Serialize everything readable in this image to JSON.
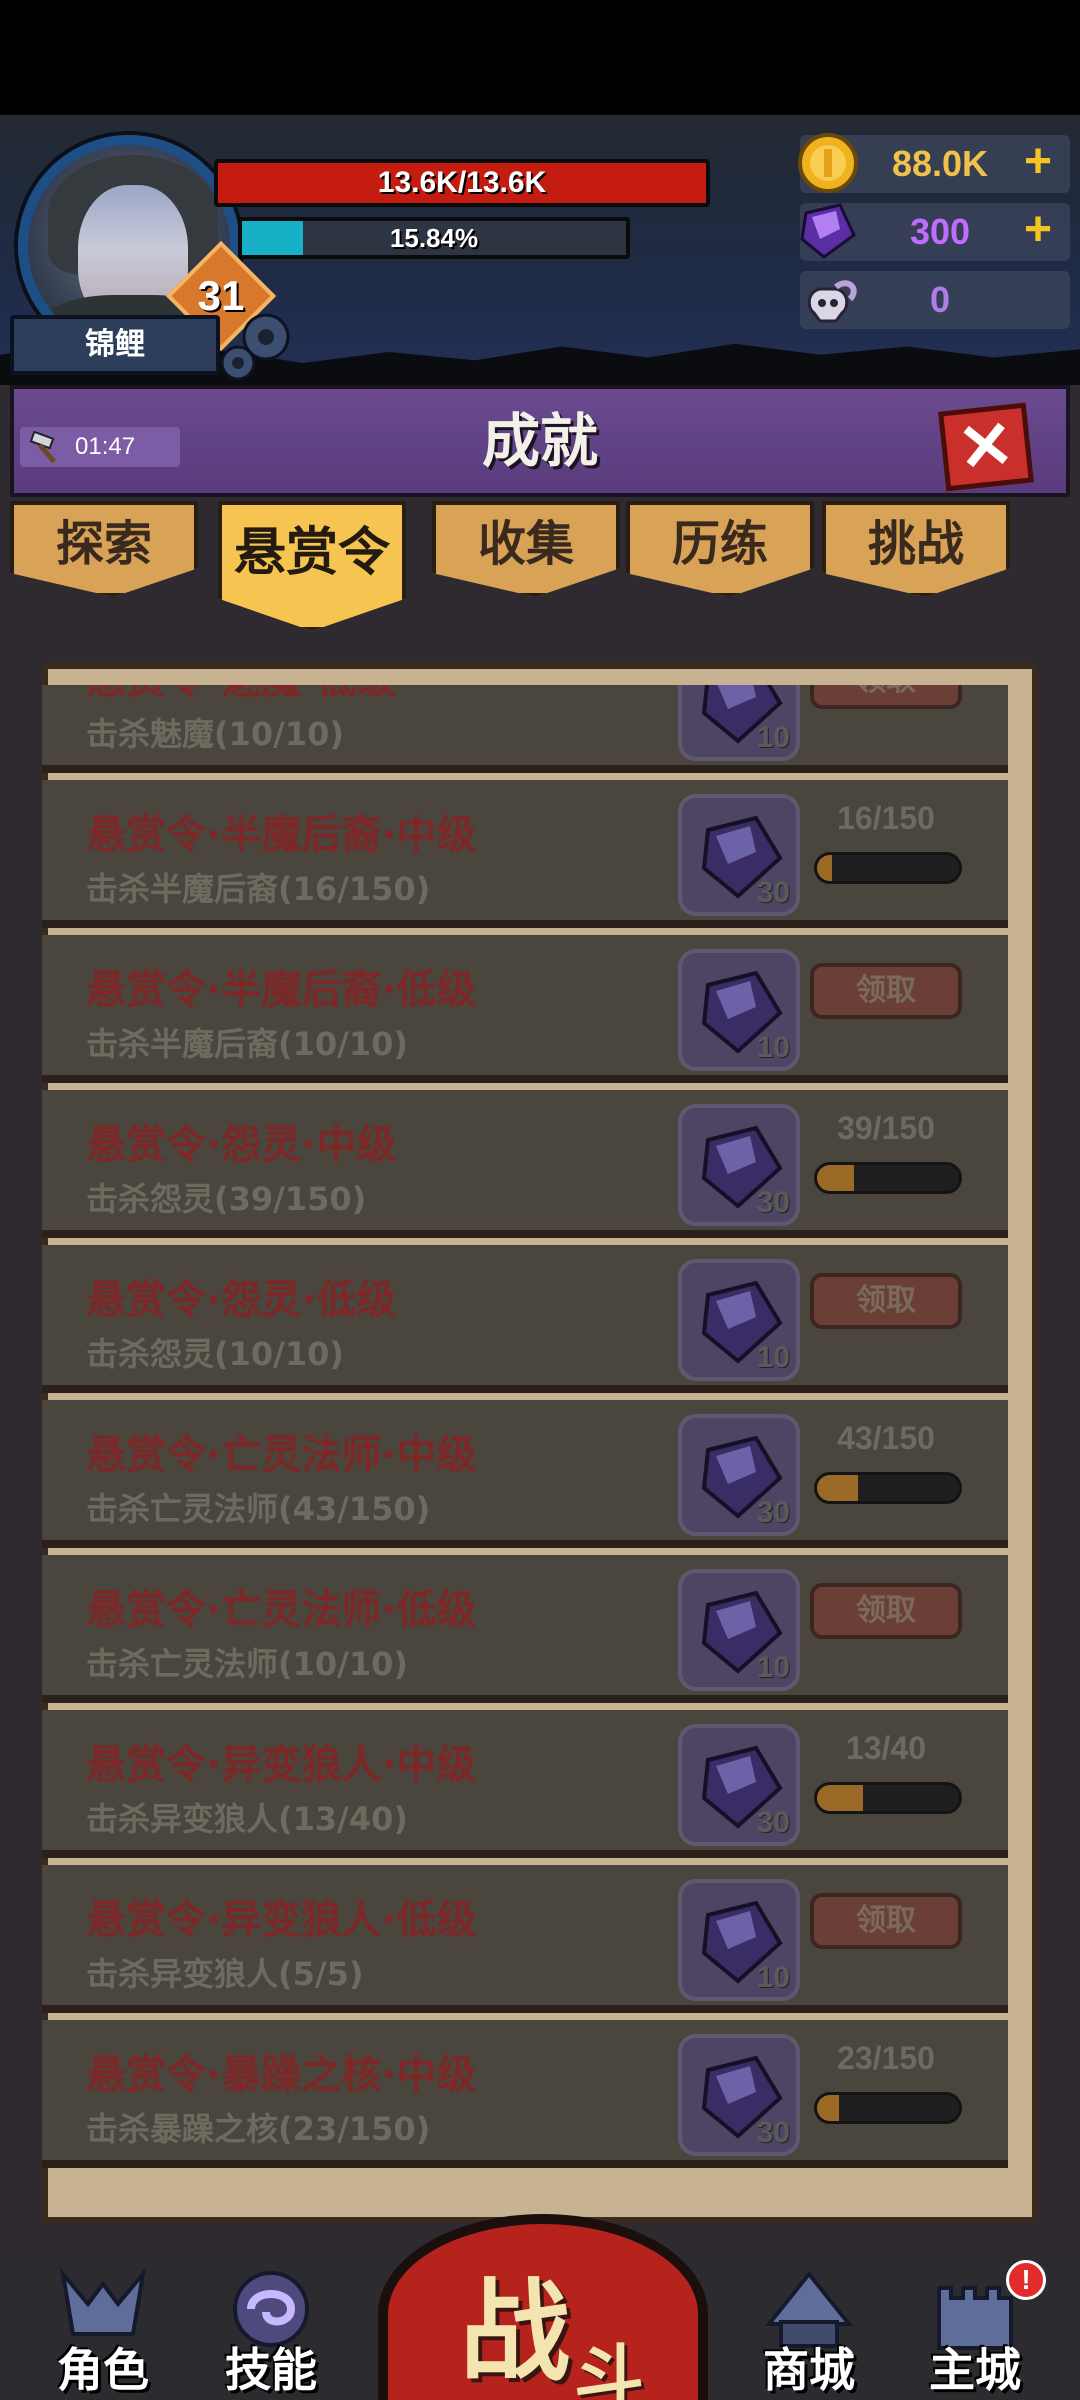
{
  "header": {
    "player_name": "锦鲤",
    "level": "31",
    "hp_text": "13.6K/13.6K",
    "exp_text": "15.84%",
    "exp_percent": 15.84,
    "currencies": [
      {
        "name": "gold-coin-icon",
        "value": "88.0K",
        "color": "#f0c24a",
        "plus": "+"
      },
      {
        "name": "purple-crystal-icon",
        "value": "300",
        "color": "#c06cff",
        "plus": "+"
      },
      {
        "name": "ram-skull-icon",
        "value": "0",
        "color": "#b07ce6"
      }
    ]
  },
  "panel": {
    "title": "成就",
    "timer": "01:47",
    "close_label": "✕",
    "tabs": [
      {
        "label": "探索",
        "active": false
      },
      {
        "label": "悬赏令",
        "active": true
      },
      {
        "label": "收集",
        "active": false
      },
      {
        "label": "历练",
        "active": false
      },
      {
        "label": "挑战",
        "active": false
      }
    ]
  },
  "achievements": [
    {
      "title": "悬赏令·魅魔·低级",
      "desc": "击杀魅魔(10/10)",
      "reward": "10",
      "status": "claim",
      "claim_label": "领取"
    },
    {
      "title": "悬赏令·半魔后裔·中级",
      "desc": "击杀半魔后裔(16/150)",
      "reward": "30",
      "status": "progress",
      "progress_text": "16/150",
      "progress": 0.107
    },
    {
      "title": "悬赏令·半魔后裔·低级",
      "desc": "击杀半魔后裔(10/10)",
      "reward": "10",
      "status": "claim",
      "claim_label": "领取"
    },
    {
      "title": "悬赏令·怨灵·中级",
      "desc": "击杀怨灵(39/150)",
      "reward": "30",
      "status": "progress",
      "progress_text": "39/150",
      "progress": 0.26
    },
    {
      "title": "悬赏令·怨灵·低级",
      "desc": "击杀怨灵(10/10)",
      "reward": "10",
      "status": "claim",
      "claim_label": "领取"
    },
    {
      "title": "悬赏令·亡灵法师·中级",
      "desc": "击杀亡灵法师(43/150)",
      "reward": "30",
      "status": "progress",
      "progress_text": "43/150",
      "progress": 0.287
    },
    {
      "title": "悬赏令·亡灵法师·低级",
      "desc": "击杀亡灵法师(10/10)",
      "reward": "10",
      "status": "claim",
      "claim_label": "领取"
    },
    {
      "title": "悬赏令·异变狼人·中级",
      "desc": "击杀异变狼人(13/40)",
      "reward": "30",
      "status": "progress",
      "progress_text": "13/40",
      "progress": 0.325
    },
    {
      "title": "悬赏令·异变狼人·低级",
      "desc": "击杀异变狼人(5/5)",
      "reward": "10",
      "status": "claim",
      "claim_label": "领取"
    },
    {
      "title": "悬赏令·暴躁之核·中级",
      "desc": "击杀暴躁之核(23/150)",
      "reward": "30",
      "status": "progress",
      "progress_text": "23/150",
      "progress": 0.153
    }
  ],
  "bottom_nav": {
    "items": [
      {
        "label": "角色",
        "icon": "character-helmet-icon"
      },
      {
        "label": "技能",
        "icon": "skill-swirl-icon"
      },
      {
        "label": "商城",
        "icon": "shop-tent-icon"
      },
      {
        "label": "主城",
        "icon": "castle-icon"
      }
    ],
    "battle_big": "战",
    "battle_small": "斗",
    "alert": "!"
  }
}
